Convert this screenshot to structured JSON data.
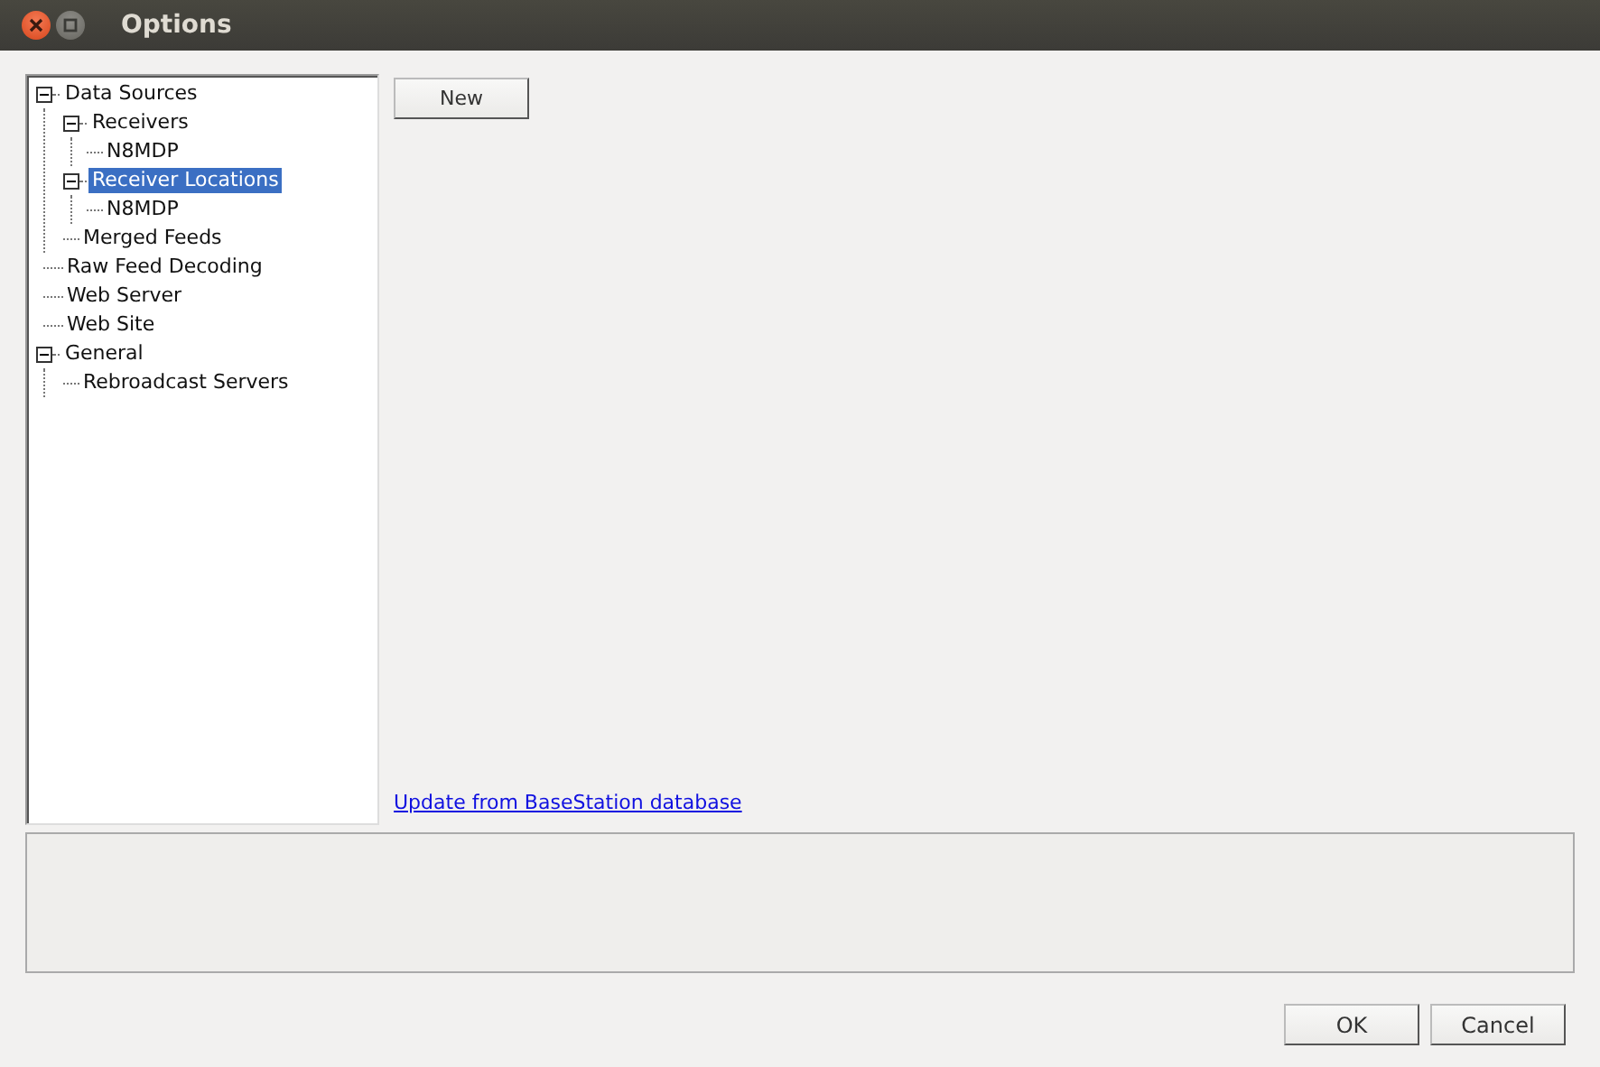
{
  "window": {
    "title": "Options"
  },
  "tree": [
    {
      "label": "Data Sources",
      "expanded": true,
      "selected": false,
      "children": [
        {
          "label": "Receivers",
          "expanded": true,
          "selected": false,
          "children": [
            {
              "label": "N8MDP",
              "selected": false
            }
          ]
        },
        {
          "label": "Receiver Locations",
          "expanded": true,
          "selected": true,
          "children": [
            {
              "label": "N8MDP",
              "selected": false
            }
          ]
        },
        {
          "label": "Merged Feeds",
          "selected": false
        }
      ]
    },
    {
      "label": "Raw Feed Decoding",
      "selected": false
    },
    {
      "label": "Web Server",
      "selected": false
    },
    {
      "label": "Web Site",
      "selected": false
    },
    {
      "label": "General",
      "expanded": true,
      "selected": false,
      "children": [
        {
          "label": "Rebroadcast Servers",
          "selected": false
        }
      ]
    }
  ],
  "new_button": "New",
  "link": "Update from BaseStation database",
  "buttons": [
    "OK",
    "Cancel"
  ]
}
